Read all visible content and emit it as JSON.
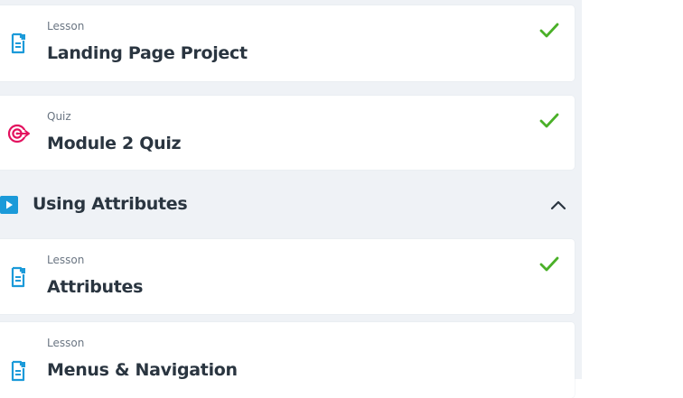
{
  "items": [
    {
      "type": "Lesson",
      "title": "Landing Page Project",
      "icon": "lesson-document-icon",
      "completed": true
    },
    {
      "type": "Quiz",
      "title": "Module 2 Quiz",
      "icon": "quiz-target-icon",
      "completed": true
    }
  ],
  "section": {
    "title": "Using Attributes",
    "icon": "video-play-icon",
    "expanded": true,
    "items": [
      {
        "type": "Lesson",
        "title": "Attributes",
        "icon": "lesson-document-icon",
        "completed": true
      },
      {
        "type": "Lesson",
        "title": "Menus & Navigation",
        "icon": "lesson-document-icon",
        "completed": false
      }
    ]
  },
  "colors": {
    "background": "#eff2f6",
    "card": "#ffffff",
    "lesson_icon": "#1b9ad9",
    "quiz_icon": "#e3105e",
    "check": "#4ab028",
    "title_text": "#2a3540",
    "type_text": "#6b7683"
  }
}
